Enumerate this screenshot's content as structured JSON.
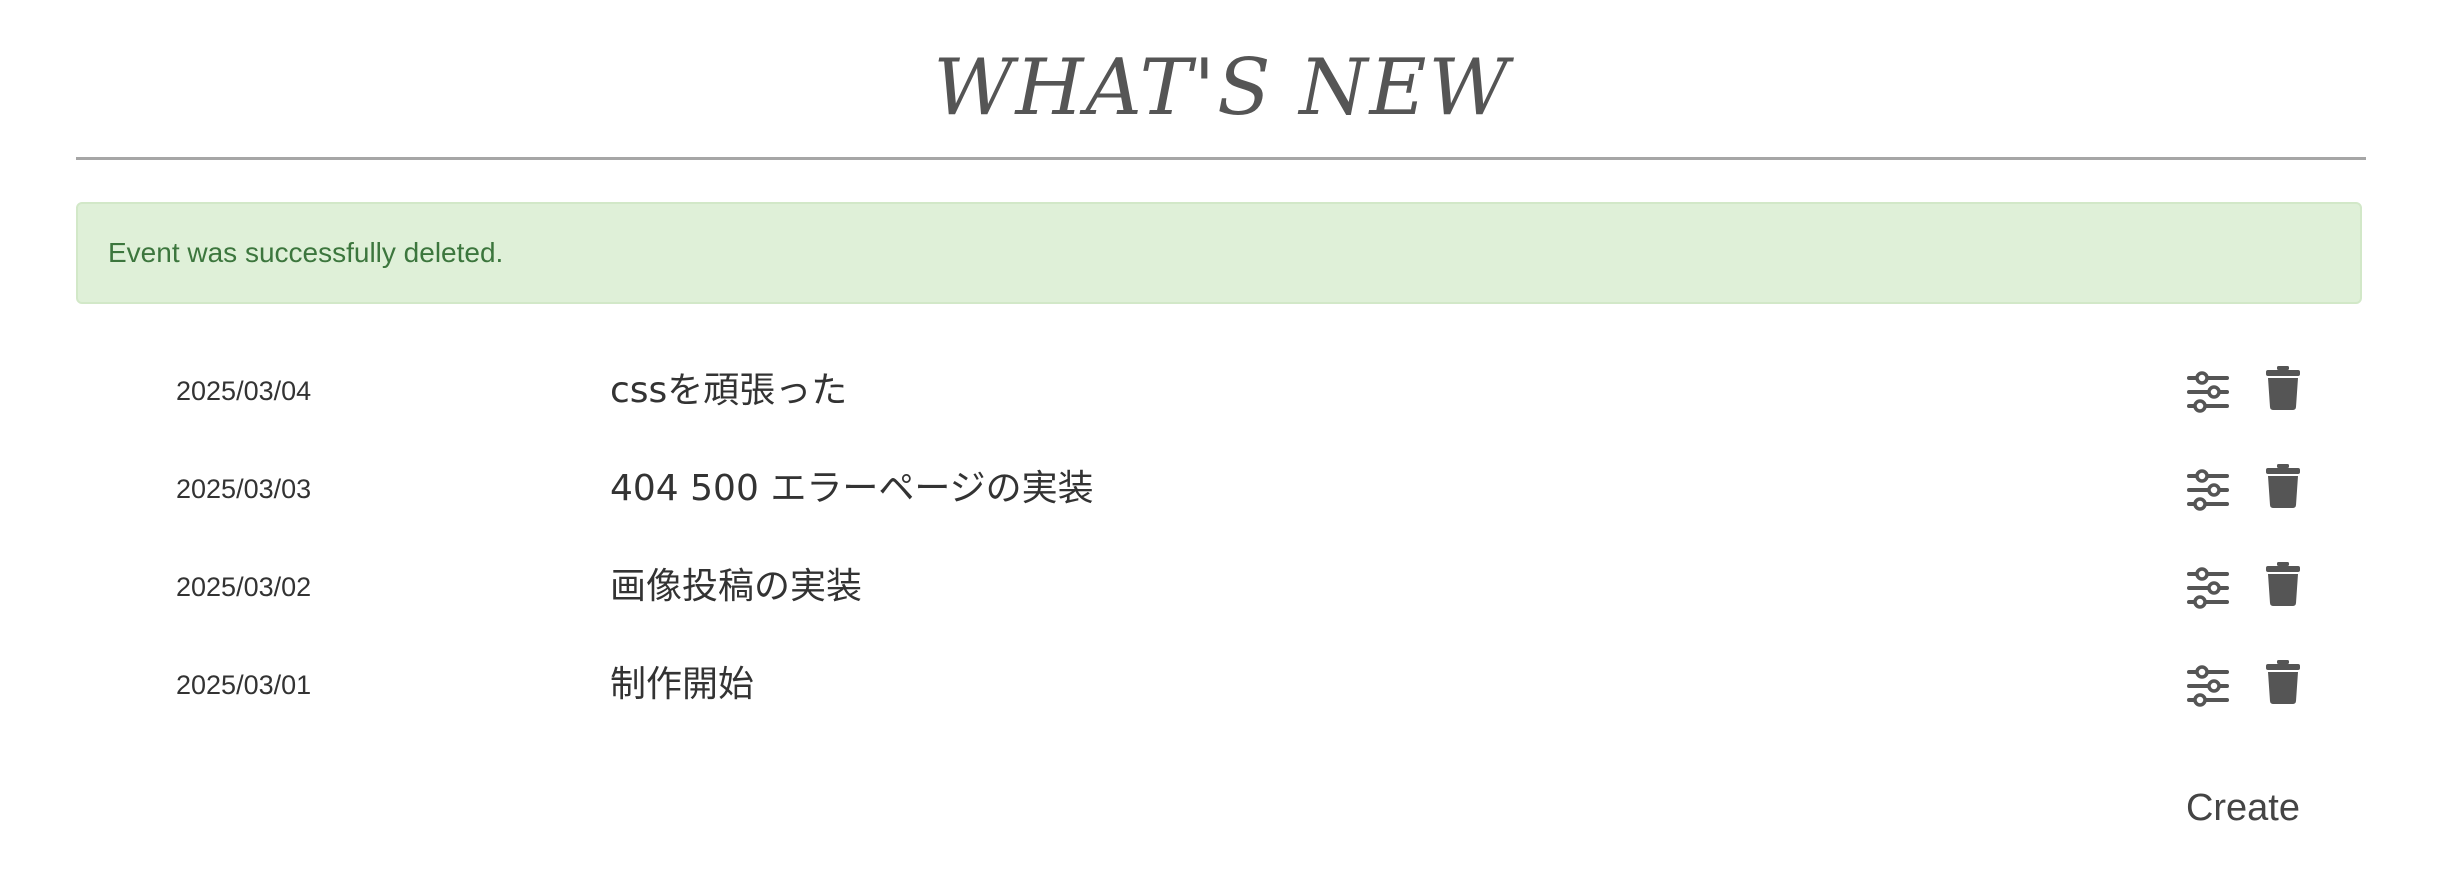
{
  "header": {
    "title": "WHAT'S NEW"
  },
  "alert": {
    "message": "Event was successfully deleted.",
    "color": "#3c763d",
    "background": "#dff0d8"
  },
  "events": [
    {
      "date": "2025/03/04",
      "title": "cssを頑張った",
      "edit_icon": "sliders-icon",
      "delete_icon": "trash-icon"
    },
    {
      "date": "2025/03/03",
      "title": "404 500 エラーページの実装",
      "edit_icon": "sliders-icon",
      "delete_icon": "trash-icon"
    },
    {
      "date": "2025/03/02",
      "title": "画像投稿の実装",
      "edit_icon": "sliders-icon",
      "delete_icon": "trash-icon"
    },
    {
      "date": "2025/03/01",
      "title": "制作開始",
      "edit_icon": "sliders-icon",
      "delete_icon": "trash-icon"
    }
  ],
  "actions": {
    "create_label": "Create"
  },
  "colors": {
    "icon": "#555555",
    "text": "#333333",
    "rule": "#a6a6a6"
  }
}
